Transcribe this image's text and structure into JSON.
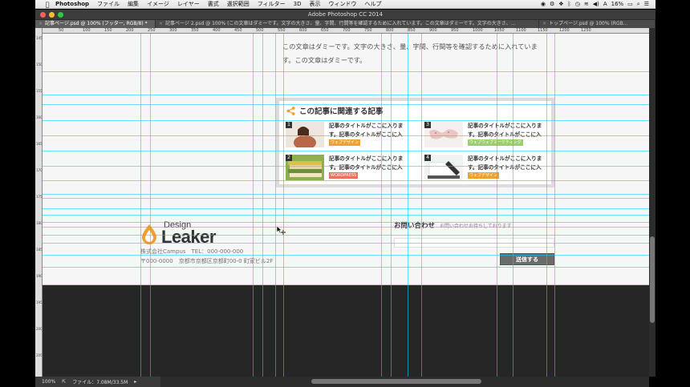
{
  "menubar": {
    "app_name": "Photoshop",
    "items": [
      "ファイル",
      "編集",
      "イメージ",
      "レイヤー",
      "書式",
      "選択範囲",
      "フィルター",
      "3D",
      "表示",
      "ウィンドウ",
      "ヘルプ"
    ],
    "battery": "16%",
    "input_method": "A"
  },
  "window": {
    "title": "Adobe Photoshop CC 2014"
  },
  "tabs": [
    {
      "label": "記事ページ.psd @ 100% (フッター, RGB/8) *",
      "active": true
    },
    {
      "label": "記事ページ 2.psd @ 100% (この文章はダミーです。文字の大きさ、量、字間、行間等を確認するために入れています。この文章はダミーです。文字の大きさ、...",
      "active": false
    },
    {
      "label": "トップページ.psd @ 100% (RGB...",
      "active": false
    }
  ],
  "ruler": {
    "h_labels": [
      "50",
      "100",
      "150",
      "200",
      "250",
      "300",
      "350",
      "400",
      "450",
      "500",
      "550",
      "600",
      "650",
      "700",
      "750",
      "800",
      "850",
      "900",
      "950",
      "1000",
      "1050",
      "1100",
      "1150",
      "1200",
      "1250"
    ],
    "v_labels": [
      "1450",
      "1500",
      "1550",
      "1600",
      "1650",
      "1700",
      "1750",
      "1800",
      "1850",
      "1900",
      "1950",
      "2000",
      "2050"
    ]
  },
  "article": {
    "body_text": "この文章はダミーです。文字の大きさ、量、字間、行間等を確認するために入れています。この文章はダミーです。"
  },
  "related": {
    "title": "この記事に関連する記事",
    "items": [
      {
        "num": "1",
        "title": "記事のタイトルがここに入ります。記事のタイトルがここに入",
        "tag": "ウェブデザイン",
        "tag_color": "#f0a030"
      },
      {
        "num": "2",
        "title": "記事のタイトルがここに入ります。記事のタイトルがここに入",
        "tag": "WORDPRESS",
        "tag_color": "#e8735a"
      },
      {
        "num": "3",
        "title": "記事のタイトルがここに入ります。記事のタイトルがここに入",
        "tag": "ウェブウェブマーケティング",
        "tag_color": "#9ccf6a"
      },
      {
        "num": "4",
        "title": "記事のタイトルがここに入ります。記事のタイトルがここに入",
        "tag": "ウェブデザイン",
        "tag_color": "#f0a030"
      }
    ]
  },
  "footer": {
    "logo_top": "Design",
    "logo_main": "Leaker",
    "company_line1": "株式会社Campus　TEL：000-000-000",
    "company_line2": "〒000-0000　京都市京都区京都町00-0 町家ビル2F",
    "contact_title": "お問い合わせ",
    "contact_sub": "お問い合わせお待ちしております",
    "send_label": "送信する"
  },
  "status": {
    "zoom": "100%",
    "file_info": "ファイル：7.08M/33.5M"
  },
  "colors": {
    "guide": "#00d2ff",
    "accent_orange": "#f0a030"
  }
}
